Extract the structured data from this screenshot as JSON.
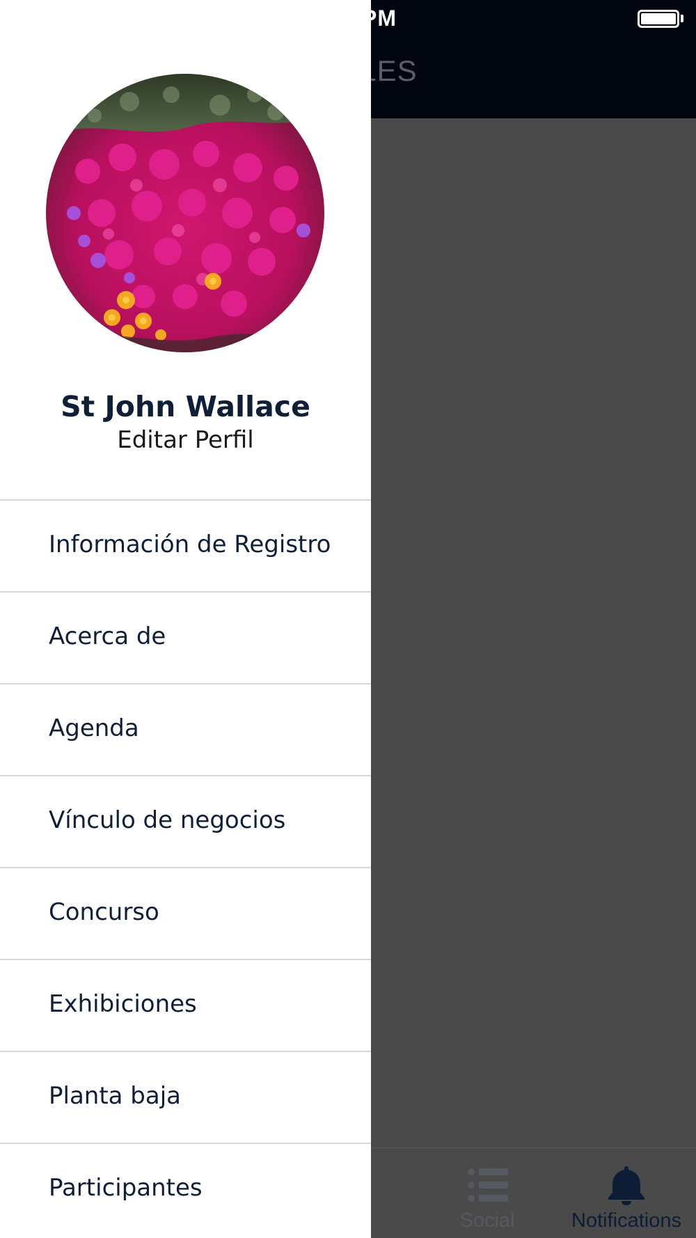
{
  "status_bar": {
    "time_fragment": "PM"
  },
  "nav_bar": {
    "title_fragment": "CIALES"
  },
  "tab_bar": {
    "tabs": [
      {
        "label": "Social",
        "icon": "list-icon",
        "selected": false
      },
      {
        "label": "Notifications",
        "icon": "bell-icon",
        "selected": true
      }
    ]
  },
  "drawer": {
    "profile": {
      "name": "St John Wallace",
      "edit_label": "Editar Perfil",
      "avatar": "flower-photo"
    },
    "menu": [
      {
        "label": "Información de Registro"
      },
      {
        "label": "Acerca de"
      },
      {
        "label": "Agenda"
      },
      {
        "label": "Vínculo de negocios"
      },
      {
        "label": "Concurso"
      },
      {
        "label": "Exhibiciones"
      },
      {
        "label": "Planta baja"
      },
      {
        "label": "Participantes"
      }
    ]
  },
  "colors": {
    "nav_background": "#020610",
    "overlay_gray": "#4a4a4a",
    "menu_text": "#0f1f38",
    "divider": "#d8d8d8",
    "selected_tab": "#0d1d36"
  }
}
